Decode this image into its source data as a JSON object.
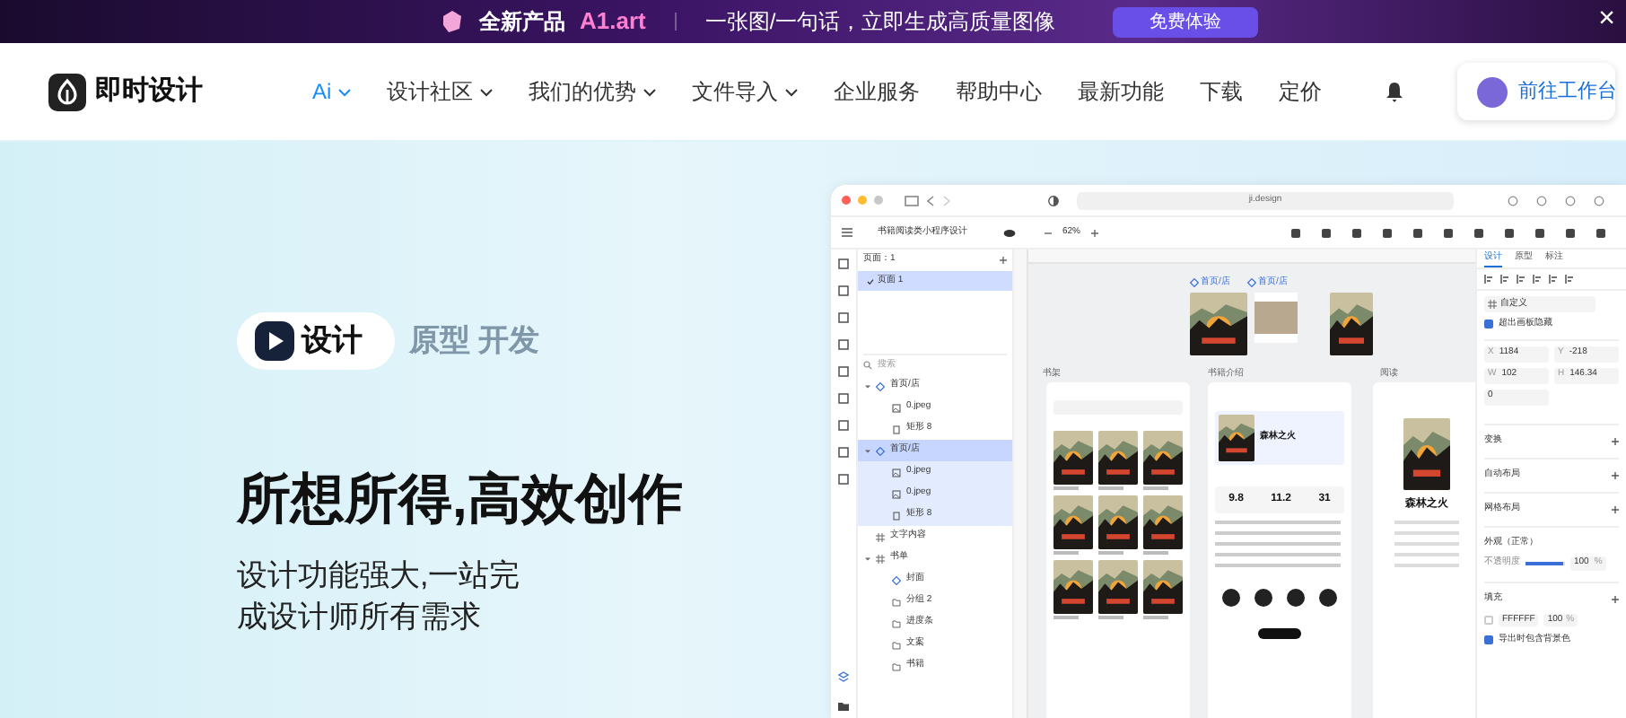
{
  "banner": {
    "product_label": "全新产品",
    "product_name": "A1.art",
    "tagline": "一张图/一句话，立即生成高质量图像",
    "button": "免费体验",
    "close": "×"
  },
  "nav": {
    "logo_text": "即时设计",
    "items": [
      {
        "label": "Ai",
        "has_menu": true,
        "selected": true
      },
      {
        "label": "设计社区",
        "has_menu": true,
        "selected": false
      },
      {
        "label": "我们的优势",
        "has_menu": true,
        "selected": false
      },
      {
        "label": "文件导入",
        "has_menu": true,
        "selected": false
      },
      {
        "label": "企业服务",
        "has_menu": false,
        "selected": false
      },
      {
        "label": "帮助中心",
        "has_menu": false,
        "selected": false
      },
      {
        "label": "最新功能",
        "has_menu": false,
        "selected": false
      },
      {
        "label": "下载",
        "has_menu": false,
        "selected": false
      },
      {
        "label": "定价",
        "has_menu": false,
        "selected": false
      }
    ],
    "workspace_button": "前往工作台"
  },
  "hero": {
    "badge": "设计",
    "badge_more": "原型 开发",
    "headline": "所想所得,高效创作",
    "subtitle": "设计功能强大,一站完成设计师所有需求"
  },
  "app": {
    "url": "ji.design",
    "file_name": "书籍阅读类小程序设计",
    "zoom": "62%",
    "pages_label": "页面：1",
    "pages": [
      {
        "label": "页面 1",
        "selected": true
      }
    ],
    "search_placeholder": "搜索",
    "layers": [
      {
        "label": "首页/店",
        "kind": "component",
        "selected": false,
        "children": [
          {
            "label": "0.jpeg",
            "kind": "image",
            "selected": false
          },
          {
            "label": "矩形 8",
            "kind": "rect",
            "selected": false
          }
        ]
      },
      {
        "label": "首页/店",
        "kind": "component",
        "selected": true,
        "children": [
          {
            "label": "0.jpeg",
            "kind": "image",
            "selected": true
          },
          {
            "label": "0.jpeg",
            "kind": "image",
            "selected": true
          },
          {
            "label": "矩形 8",
            "kind": "rect",
            "selected": true
          }
        ]
      },
      {
        "label": "文字内容",
        "kind": "frame",
        "selected": false
      },
      {
        "label": "书单",
        "kind": "frame",
        "selected": false,
        "children": [
          {
            "label": "封面",
            "kind": "component",
            "selected": false
          },
          {
            "label": "分组 2",
            "kind": "folder",
            "selected": false
          },
          {
            "label": "进度条",
            "kind": "folder",
            "selected": false
          },
          {
            "label": "文案",
            "kind": "folder",
            "selected": false
          },
          {
            "label": "书籍",
            "kind": "folder",
            "selected": false
          }
        ]
      }
    ],
    "component_labels": [
      "首页/店",
      "首页/店"
    ],
    "frame_labels": [
      "书架",
      "书籍介绍",
      "阅读"
    ],
    "detail_title": "森林之火",
    "stats": [
      "9.8",
      "11.2",
      "31"
    ],
    "reader_title": "森林之火",
    "panel": {
      "tabs": [
        {
          "label": "设计",
          "selected": true
        },
        {
          "label": "原型",
          "selected": false
        },
        {
          "label": "标注",
          "selected": false
        }
      ],
      "preset": "自定义",
      "clip": {
        "label": "超出画板隐藏",
        "checked": true
      },
      "fields": [
        {
          "label": "X",
          "value": "1184"
        },
        {
          "label": "Y",
          "value": "-218"
        },
        {
          "label": "W",
          "value": "102"
        },
        {
          "label": "H",
          "value": "146.34"
        }
      ],
      "rotation": "0",
      "sections": [
        "变换",
        "自动布局",
        "网格布局"
      ],
      "appearance": "外观（正常）",
      "opacity_label": "不透明度",
      "opacity": {
        "level": 0.95
      },
      "opacity_value": "100",
      "percent": "%",
      "fill_label": "填充",
      "fill_hex": "FFFFFF",
      "fill_opacity": "100",
      "fill_percent": "%",
      "export_bg": {
        "label": "导出时包含背景色",
        "checked": true
      }
    }
  }
}
